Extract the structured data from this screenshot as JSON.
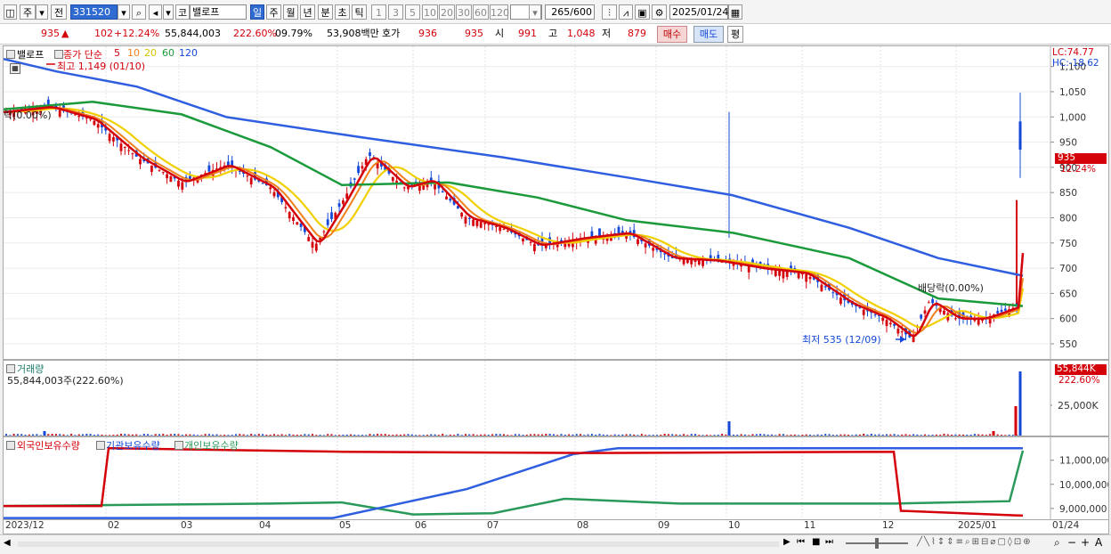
{
  "toolbar": {
    "period_week_short": "주",
    "prev_label": "전",
    "code_value": "331520",
    "market_badge": "코",
    "stock_name": "밸로프",
    "period_day": "일",
    "period_week": "주",
    "period_month": "월",
    "period_year": "년",
    "period_min": "분",
    "period_sec": "초",
    "period_tick": "틱",
    "intervals": [
      "1",
      "3",
      "5",
      "10",
      "20",
      "30",
      "60",
      "120"
    ],
    "count_display": "265",
    "count_total": "/600",
    "date_value": "2025/01/24"
  },
  "quote": {
    "price": "935",
    "change": "102",
    "change_pct": "+12.24%",
    "volume": "55,844,003",
    "volume_ratio": "222.60%",
    "turnover": "09.79%",
    "amount": "53,908백만",
    "hoga_label": "호가",
    "bid": "936",
    "ask": "935",
    "open_label": "시",
    "open": "991",
    "high_label": "고",
    "high": "1,048",
    "low_label": "저",
    "low": "879",
    "buy_label": "매수",
    "sell_label": "매도",
    "avg_label": "평"
  },
  "price_panel": {
    "stock_tag": "밸로프",
    "ma_title": "종가 단순",
    "ma_periods": [
      "5",
      "10",
      "20",
      "60",
      "120"
    ],
    "ma_colors": [
      "#d4000a",
      "#f0801a",
      "#e8d800",
      "#1a9a3a",
      "#2f5fe0"
    ],
    "high_note": "최고 1,149 (01/10)",
    "low_note": "최저 535 (12/09)",
    "left_note": "락(0.00%)",
    "mid_note": "배당락(0.00%)",
    "lc": "LC:74.77",
    "hc": "HC:-18.62",
    "current_price": "935",
    "current_pct": "12.24%",
    "y_ticks": [
      "1,100",
      "1,050",
      "1,000",
      "950",
      "900",
      "850",
      "800",
      "750",
      "700",
      "650",
      "600",
      "550"
    ]
  },
  "volume_panel": {
    "title": "거래량",
    "value_text": "55,844,003주(222.60%)",
    "current": "55,844K",
    "current_pct": "222.60%",
    "tick": "25,000K"
  },
  "holdings_panel": {
    "foreign_label": "외국인보유수량",
    "inst_label": "기관보유수량",
    "indiv_label": "개인보유수량",
    "y_ticks": [
      "11,000,000",
      "10,000,000",
      "9,000,000"
    ]
  },
  "x_axis": {
    "labels": [
      "2023/12",
      "02",
      "03",
      "04",
      "05",
      "06",
      "07",
      "08",
      "09",
      "10",
      "11",
      "12",
      "2025/01",
      "01/24"
    ]
  },
  "chart_data": {
    "type": "candlestick",
    "title": "밸로프",
    "y_range": [
      520,
      1140
    ],
    "series_ma": [
      "5",
      "10",
      "20",
      "60",
      "120"
    ],
    "last": {
      "open": 991,
      "high": 1048,
      "low": 879,
      "close": 935
    },
    "period_high": {
      "value": 1149,
      "date": "01/10"
    },
    "period_low": {
      "value": 535,
      "date": "12/09"
    },
    "ma120_points": [
      [
        0,
        1115
      ],
      [
        60,
        1090
      ],
      [
        150,
        1060
      ],
      [
        250,
        1000
      ],
      [
        400,
        960
      ],
      [
        560,
        920
      ],
      [
        700,
        880
      ],
      [
        818,
        845
      ],
      [
        950,
        780
      ],
      [
        1050,
        720
      ],
      [
        1145,
        685
      ]
    ],
    "ma60_points": [
      [
        0,
        1015
      ],
      [
        100,
        1030
      ],
      [
        200,
        1005
      ],
      [
        300,
        940
      ],
      [
        380,
        865
      ],
      [
        500,
        870
      ],
      [
        600,
        840
      ],
      [
        700,
        795
      ],
      [
        820,
        770
      ],
      [
        950,
        720
      ],
      [
        1050,
        640
      ],
      [
        1145,
        625
      ]
    ],
    "close_points": [
      [
        0,
        1010
      ],
      [
        50,
        1020
      ],
      [
        100,
        995
      ],
      [
        150,
        920
      ],
      [
        200,
        870
      ],
      [
        250,
        905
      ],
      [
        300,
        860
      ],
      [
        350,
        745
      ],
      [
        380,
        830
      ],
      [
        410,
        925
      ],
      [
        450,
        860
      ],
      [
        480,
        875
      ],
      [
        520,
        800
      ],
      [
        560,
        780
      ],
      [
        600,
        745
      ],
      [
        650,
        760
      ],
      [
        700,
        770
      ],
      [
        750,
        720
      ],
      [
        800,
        715
      ],
      [
        850,
        700
      ],
      [
        900,
        690
      ],
      [
        950,
        630
      ],
      [
        990,
        600
      ],
      [
        1020,
        560
      ],
      [
        1040,
        635
      ],
      [
        1070,
        600
      ],
      [
        1100,
        600
      ],
      [
        1140,
        625
      ],
      [
        1145,
        935
      ]
    ],
    "volume": {
      "last": 55844003,
      "unit": "주"
    },
    "holdings": {
      "foreign": [
        [
          0,
          9.1
        ],
        [
          110,
          9.1
        ],
        [
          118,
          11.5
        ],
        [
          380,
          11.35
        ],
        [
          660,
          11.3
        ],
        [
          1000,
          11.35
        ],
        [
          1008,
          8.9
        ],
        [
          1145,
          8.7
        ]
      ],
      "institution": [
        [
          0,
          8.6
        ],
        [
          370,
          8.6
        ],
        [
          420,
          9.0
        ],
        [
          520,
          9.8
        ],
        [
          640,
          11.25
        ],
        [
          690,
          11.5
        ],
        [
          1145,
          11.5
        ]
      ],
      "individual": [
        [
          0,
          9.1
        ],
        [
          300,
          9.2
        ],
        [
          380,
          9.25
        ],
        [
          460,
          8.75
        ],
        [
          550,
          8.8
        ],
        [
          630,
          9.4
        ],
        [
          760,
          9.2
        ],
        [
          1000,
          9.2
        ],
        [
          1130,
          9.3
        ],
        [
          1145,
          11.4
        ]
      ]
    }
  }
}
